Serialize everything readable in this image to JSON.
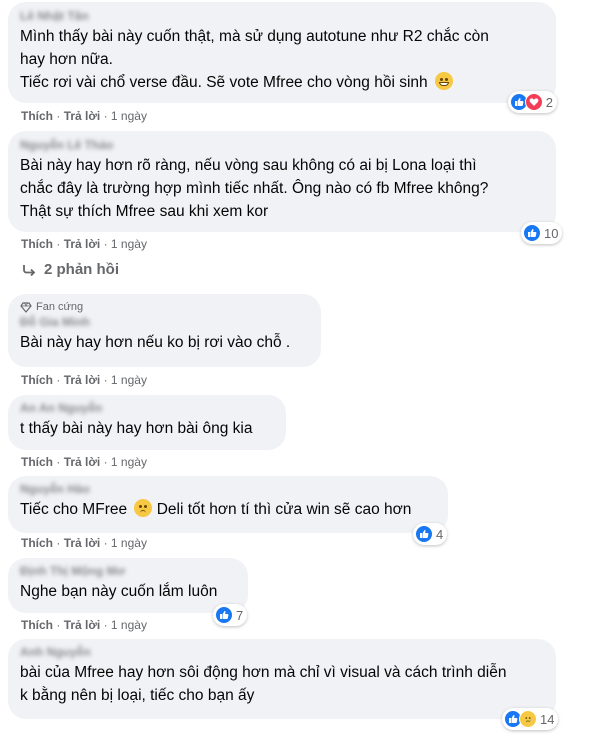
{
  "actions": {
    "like": "Thích",
    "reply": "Trả lời",
    "time": "1 ngày",
    "separator": "·"
  },
  "replies_link": "2 phản hồi",
  "fan_badge": "Fan cứng",
  "comments": [
    {
      "author": "Lê Nhật Tân",
      "lines": [
        "Mình thấy bài này cuốn thật, mà sử dụng autotune như R2 chắc còn",
        "hay hơn nữa.",
        "Tiếc rơi vài chổ verse đầu. Sẽ vote Mfree cho vòng hồi sinh"
      ],
      "reactions": [
        "like",
        "love"
      ],
      "count": "2"
    },
    {
      "author": "Nguyễn Lê Thảo",
      "lines": [
        "Bài này hay hơn rõ ràng, nếu vòng sau không có ai bị Lona loại thì",
        "chắc đây là trường hợp mình tiếc nhất. Ông nào có fb Mfree không?",
        "Thật sự thích Mfree sau khi xem kor"
      ],
      "reactions": [
        "like"
      ],
      "count": "10"
    },
    {
      "author": "Đỗ Gia Minh",
      "lines": [
        "Bài này hay hơn nếu ko bị rơi vào chỗ ."
      ]
    },
    {
      "author": "An An Nguyễn",
      "lines": [
        "t thấy bài này hay hơn bài ông kia"
      ]
    },
    {
      "author": "Nguyễn Hào",
      "lines": [
        "Tiếc cho MFree",
        "Deli tốt hơn tí thì cửa win sẽ cao hơn"
      ],
      "reactions": [
        "like"
      ],
      "count": "4"
    },
    {
      "author": "Định Thị Mộng Mơ",
      "lines": [
        "Nghe bạn này cuốn lắm luôn"
      ],
      "reactions": [
        "like"
      ],
      "count": "7"
    },
    {
      "author": "Anh Nguyễn",
      "lines": [
        "bài của Mfree hay hơn sôi động hơn mà chỉ vì visual và cách trình diễn",
        "k bằng nên bị loại, tiếc cho bạn ấy"
      ],
      "reactions": [
        "like",
        "sad"
      ],
      "count": "14"
    }
  ],
  "colors": {
    "like": "#1877f2",
    "love": "#f33e58",
    "sad": "#f7c843",
    "bubble": "#f0f2f5"
  }
}
